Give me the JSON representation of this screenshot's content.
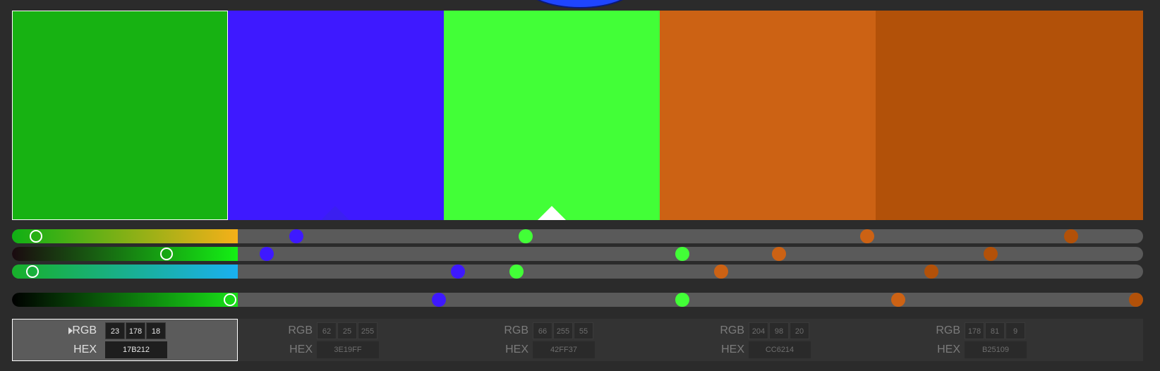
{
  "swatches": [
    {
      "hex": "17B212",
      "color": "#17B212",
      "rgb": [
        "23",
        "178",
        "18"
      ]
    },
    {
      "hex": "3E19FF",
      "color": "#3E19FF",
      "rgb": [
        "62",
        "25",
        "255"
      ]
    },
    {
      "hex": "42FF37",
      "color": "#42FF37",
      "rgb": [
        "66",
        "255",
        "55"
      ]
    },
    {
      "hex": "CC6214",
      "color": "#CC6214",
      "rgb": [
        "204",
        "98",
        "20"
      ]
    },
    {
      "hex": "B25109",
      "color": "#B25109",
      "rgb": [
        "178",
        "81",
        "9"
      ]
    }
  ],
  "labels": {
    "rgb": "RGB",
    "hex": "HEX"
  },
  "selected_index": 0,
  "active_base_index": 2
}
